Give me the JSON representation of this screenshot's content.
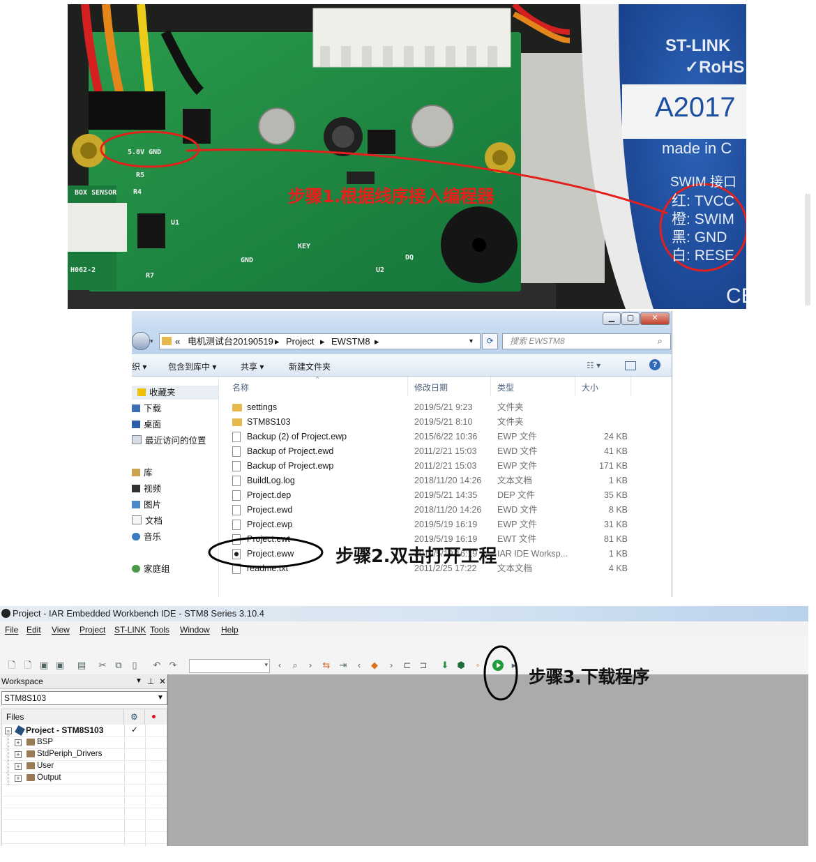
{
  "photo": {
    "step_label": "步骤1.根据线序接入编程器",
    "board_silk": [
      "5.0V GND",
      "BOX SENSOR",
      "H062-2",
      "U1",
      "R5",
      "R4",
      "R7",
      "U2",
      "DQ",
      "GND",
      "KEY"
    ],
    "stlink_label": {
      "brand": "ST-LINK",
      "rohs": "✓RoHS",
      "serial": "A2017",
      "origin": "made in C",
      "swim_title": "SWIM 接口",
      "wires": [
        {
          "color_name": "红:",
          "signal": "TVCC"
        },
        {
          "color_name": "橙:",
          "signal": "SWIM"
        },
        {
          "color_name": "黑:",
          "signal": "GND"
        },
        {
          "color_name": "白:",
          "signal": "RESE"
        }
      ],
      "ce": "CE"
    },
    "colors": {
      "board": "#1f8a3e",
      "label": "#1c4fa2",
      "annotation": "#e3201b"
    }
  },
  "explorer": {
    "address": [
      "«",
      "电机测试台20190519",
      "Project",
      "EWSTM8"
    ],
    "search_placeholder": "搜索 EWSTM8",
    "commands": [
      "织 ▾",
      "包含到库中 ▾",
      "共享 ▾",
      "新建文件夹"
    ],
    "nav": {
      "favorites_header": "收藏夹",
      "favorites": [
        "下载",
        "桌面",
        "最近访问的位置"
      ],
      "library_header": "库",
      "library": [
        "视频",
        "图片",
        "文档",
        "音乐"
      ],
      "homegroup": "家庭组"
    },
    "columns": {
      "name": "名称",
      "date": "修改日期",
      "type": "类型",
      "size": "大小"
    },
    "files": [
      {
        "name": "settings",
        "date": "2019/5/21 9:23",
        "type": "文件夹",
        "size": "",
        "kind": "folder"
      },
      {
        "name": "STM8S103",
        "date": "2019/5/21 8:10",
        "type": "文件夹",
        "size": "",
        "kind": "folder"
      },
      {
        "name": "Backup (2) of Project.ewp",
        "date": "2015/6/22 10:36",
        "type": "EWP 文件",
        "size": "24 KB",
        "kind": "file"
      },
      {
        "name": "Backup of Project.ewd",
        "date": "2011/2/21 15:03",
        "type": "EWD 文件",
        "size": "41 KB",
        "kind": "file"
      },
      {
        "name": "Backup of Project.ewp",
        "date": "2011/2/21 15:03",
        "type": "EWP 文件",
        "size": "171 KB",
        "kind": "file"
      },
      {
        "name": "BuildLog.log",
        "date": "2018/11/20 14:26",
        "type": "文本文档",
        "size": "1 KB",
        "kind": "file"
      },
      {
        "name": "Project.dep",
        "date": "2019/5/21 14:35",
        "type": "DEP 文件",
        "size": "35 KB",
        "kind": "file"
      },
      {
        "name": "Project.ewd",
        "date": "2018/11/20 14:26",
        "type": "EWD 文件",
        "size": "8 KB",
        "kind": "file"
      },
      {
        "name": "Project.ewp",
        "date": "2019/5/19 16:19",
        "type": "EWP 文件",
        "size": "31 KB",
        "kind": "file"
      },
      {
        "name": "Project.ewt",
        "date": "2019/5/19 16:19",
        "type": "EWT 文件",
        "size": "81 KB",
        "kind": "file"
      },
      {
        "name": "Project.eww",
        "date": "2019/5/19 16:19",
        "type": "IAR IDE Worksp...",
        "size": "1 KB",
        "kind": "eww"
      },
      {
        "name": "readme.txt",
        "date": "2011/2/25 17:22",
        "type": "文本文档",
        "size": "4 KB",
        "kind": "file"
      }
    ],
    "step_label": "步骤2.双击打开工程"
  },
  "iar": {
    "title": "Project - IAR Embedded Workbench IDE - STM8 Series 3.10.4",
    "menu": [
      "File",
      "Edit",
      "View",
      "Project",
      "ST-LINK",
      "Tools",
      "Window",
      "Help"
    ],
    "workspace": {
      "panel_title": "Workspace",
      "config": "STM8S103",
      "files_header": "Files",
      "project": "Project - STM8S103",
      "groups": [
        "BSP",
        "StdPeriph_Drivers",
        "User",
        "Output"
      ]
    },
    "step_label": "步骤3.下载程序",
    "colors": {
      "download_button": "#1e9c3a"
    }
  }
}
